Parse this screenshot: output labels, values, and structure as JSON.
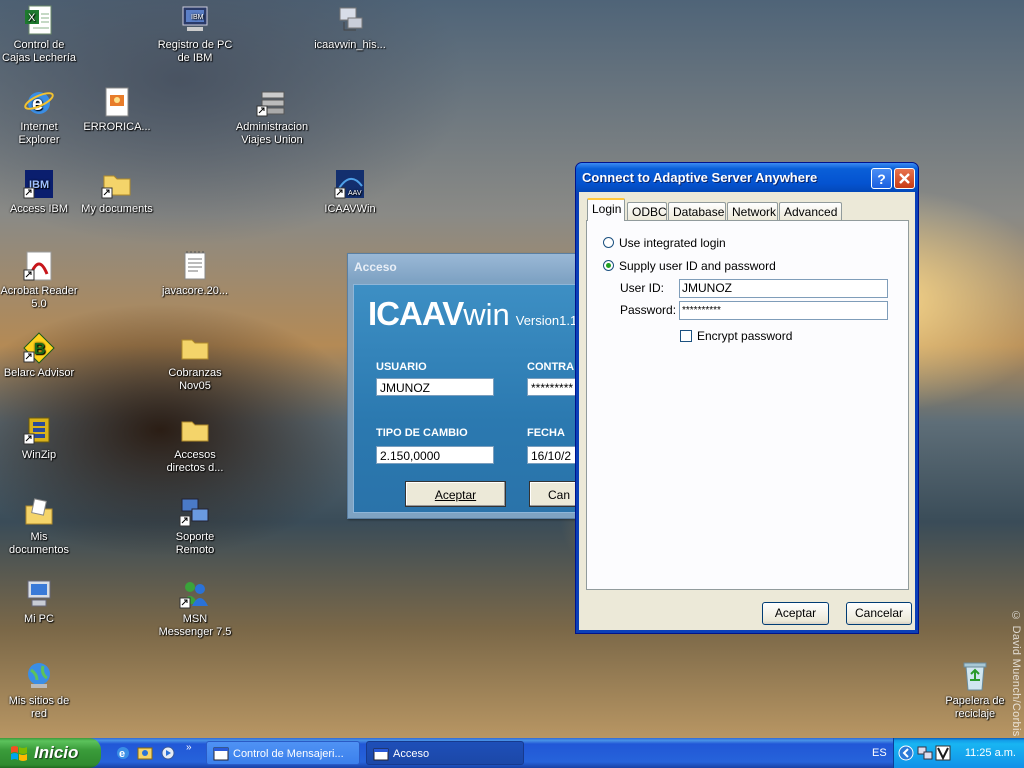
{
  "desktop": {
    "icons": [
      {
        "label": "Control de Cajas Lechería"
      },
      {
        "label": "Registro de PC de IBM"
      },
      {
        "label": "icaavwin_his..."
      },
      {
        "label": "Internet Explorer"
      },
      {
        "label": "ERRORICA..."
      },
      {
        "label": "Administracion Viajes Union"
      },
      {
        "label": "Access IBM"
      },
      {
        "label": "My documents"
      },
      {
        "label": "ICAAVWin"
      },
      {
        "label": "Acrobat Reader 5.0"
      },
      {
        "label": "javacore.20..."
      },
      {
        "label": "Belarc Advisor"
      },
      {
        "label": "Cobranzas Nov05"
      },
      {
        "label": "WinZip"
      },
      {
        "label": "Accesos directos d..."
      },
      {
        "label": "Mis documentos"
      },
      {
        "label": "Soporte Remoto"
      },
      {
        "label": "Mi PC"
      },
      {
        "label": "MSN Messenger 7.5"
      },
      {
        "label": "Mis sitios de red"
      },
      {
        "label": "Papelera de reciclaje"
      }
    ],
    "watermark": "© David Muench/Corbis"
  },
  "acceso_window": {
    "title": "Acceso",
    "logo_main": "ICAAV",
    "logo_win": "win",
    "version": "Version1.1",
    "usuario_label": "USUARIO",
    "usuario_value": "JMUNOZ",
    "contrasena_label": "CONTRA",
    "contrasena_value": "*********",
    "tipo_cambio_label": "TIPO DE CAMBIO",
    "tipo_cambio_value": "2.150,0000",
    "fecha_label": "FECHA",
    "fecha_value": "16/10/2",
    "aceptar_label": "Aceptar",
    "cancelar_label": "Can"
  },
  "connect_dialog": {
    "title": "Connect to Adaptive Server Anywhere",
    "help_label": "?",
    "close_label": "✕",
    "tabs": [
      {
        "label": "Login",
        "active": true
      },
      {
        "label": "ODBC",
        "active": false
      },
      {
        "label": "Database",
        "active": false
      },
      {
        "label": "Network",
        "active": false
      },
      {
        "label": "Advanced",
        "active": false
      }
    ],
    "radio_integrated": "Use integrated login",
    "radio_supply": "Supply user ID and password",
    "user_id_label": "User ID:",
    "user_id_value": "JMUNOZ",
    "password_label": "Password:",
    "password_value": "**********",
    "encrypt_label": "Encrypt password",
    "ok_label": "Aceptar",
    "cancel_label": "Cancelar"
  },
  "taskbar": {
    "start_label": "Inicio",
    "tasks": [
      {
        "label": "Control de Mensajeri...",
        "active": false
      },
      {
        "label": "Acceso",
        "active": true
      }
    ],
    "language": "ES",
    "clock": "11:25 a.m."
  }
}
